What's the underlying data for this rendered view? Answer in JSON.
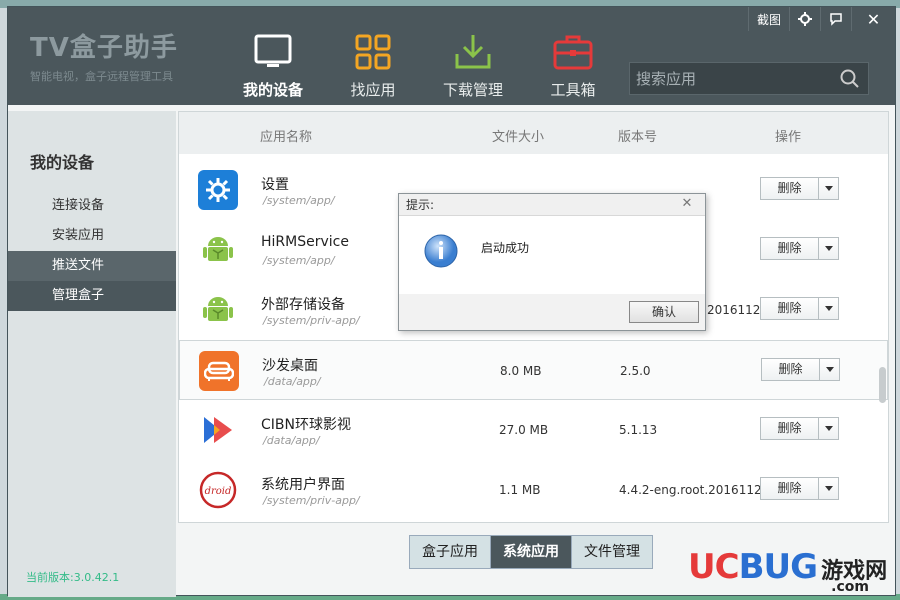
{
  "window": {
    "logo_title": "TV盒子助手",
    "logo_subtitle": "智能电视，盒子远程管理工具",
    "screenshot_label": "截图",
    "close_label": "✕"
  },
  "nav": [
    {
      "label": "我的设备",
      "icon": "tv-icon",
      "active": true
    },
    {
      "label": "找应用",
      "icon": "grid-apps-icon",
      "active": false
    },
    {
      "label": "下载管理",
      "icon": "download-icon",
      "active": false
    },
    {
      "label": "工具箱",
      "icon": "toolbox-icon",
      "active": false
    }
  ],
  "search": {
    "placeholder": "搜索应用"
  },
  "sidebar": {
    "title": "我的设备",
    "items": [
      {
        "label": "连接设备"
      },
      {
        "label": "安装应用"
      },
      {
        "label": "推送文件"
      },
      {
        "label": "管理盒子"
      }
    ],
    "version": "当前版本:3.0.42.1"
  },
  "table": {
    "headers": {
      "name": "应用名称",
      "size": "文件大小",
      "version": "版本号",
      "action": "操作"
    },
    "rows": [
      {
        "name": "设置",
        "path": "/system/app/",
        "size": "",
        "version": "",
        "icon": "settings-gear-icon"
      },
      {
        "name": "HiRMService",
        "path": "/system/app/",
        "size": "",
        "version": "",
        "icon": "android-icon"
      },
      {
        "name": "外部存储设备",
        "path": "/system/priv-app/",
        "size": "",
        "version": "20161121...",
        "icon": "android-icon"
      },
      {
        "name": "沙发桌面",
        "path": "/data/app/",
        "size": "8.0 MB",
        "version": "2.5.0",
        "icon": "sofa-icon"
      },
      {
        "name": "CIBN环球影视",
        "path": "/data/app/",
        "size": "27.0 MB",
        "version": "5.1.13",
        "icon": "cibn-play-icon"
      },
      {
        "name": "系统用户界面",
        "path": "/system/priv-app/",
        "size": "1.1 MB",
        "version": "4.4.2-eng.root.20161121...",
        "icon": "android-badge-icon"
      }
    ],
    "delete_label": "删除"
  },
  "tabs": [
    {
      "label": "盒子应用",
      "active": false
    },
    {
      "label": "系统应用",
      "active": true
    },
    {
      "label": "文件管理",
      "active": false
    }
  ],
  "dialog": {
    "title": "提示:",
    "message": "启动成功",
    "ok_label": "确认"
  },
  "watermark": {
    "brand_u": "UC",
    "brand_b": "BUG",
    "brand_cn": "游戏网",
    "domain": ".com"
  },
  "colors": {
    "header_bg": "#4b575c",
    "accent_orange": "#f4a623",
    "accent_green": "#8bc34a",
    "accent_red": "#e53a3a"
  }
}
